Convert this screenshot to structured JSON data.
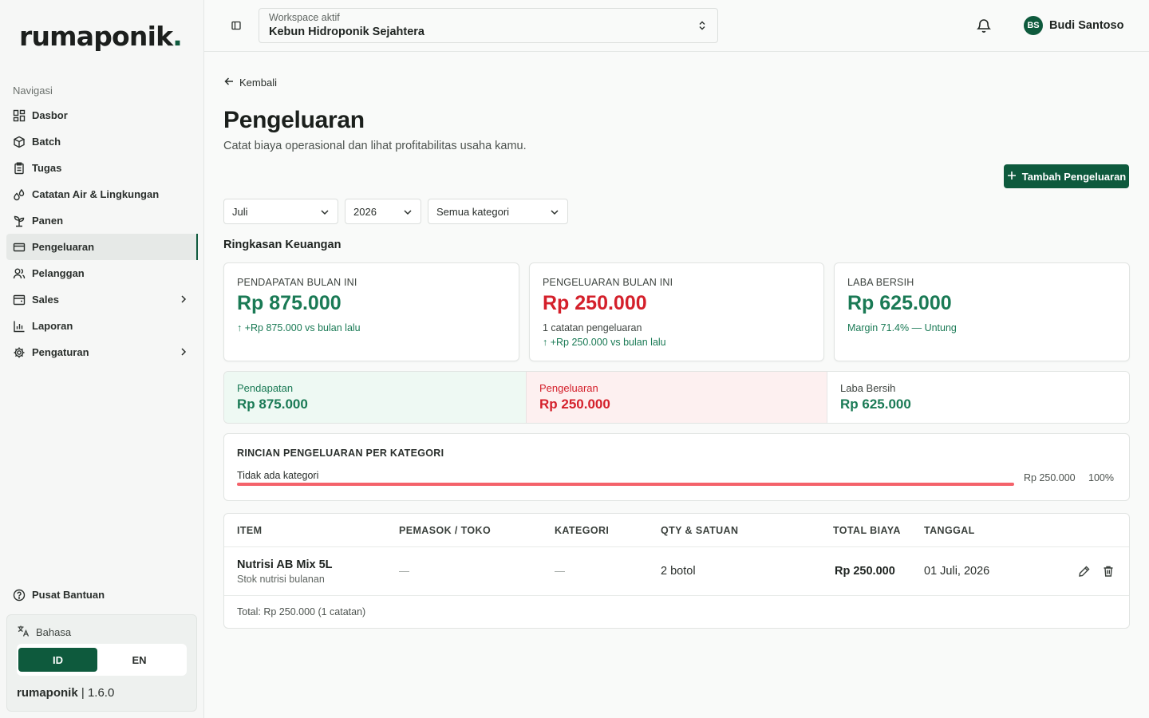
{
  "brand": {
    "logo_main": "rumaponik",
    "logo_dot": "."
  },
  "nav": {
    "heading": "Navigasi",
    "items": [
      {
        "label": "Dasbor",
        "icon": "dashboard-icon"
      },
      {
        "label": "Batch",
        "icon": "box-icon"
      },
      {
        "label": "Tugas",
        "icon": "clipboard-icon"
      },
      {
        "label": "Catatan Air & Lingkungan",
        "icon": "droplets-icon"
      },
      {
        "label": "Panen",
        "icon": "sprout-icon"
      },
      {
        "label": "Pengeluaran",
        "icon": "credit-card-icon",
        "active": true
      },
      {
        "label": "Pelanggan",
        "icon": "users-icon"
      },
      {
        "label": "Sales",
        "icon": "wallet-icon",
        "has_children": true
      },
      {
        "label": "Laporan",
        "icon": "bar-chart-icon"
      },
      {
        "label": "Pengaturan",
        "icon": "gear-icon",
        "has_children": true
      }
    ],
    "help": "Pusat Bantuan"
  },
  "language": {
    "title": "Bahasa",
    "options": [
      "ID",
      "EN"
    ],
    "selected": "ID"
  },
  "version": {
    "name": "rumaponik",
    "separator": "|",
    "number": "1.6.0"
  },
  "header": {
    "workspace_label": "Workspace aktif",
    "workspace_value": "Kebun Hidroponik Sejahtera",
    "user_initials": "BS",
    "user_name": "Budi Santoso"
  },
  "page": {
    "back": "Kembali",
    "title": "Pengeluaran",
    "subtitle": "Catat biaya operasional dan lihat profitabilitas usaha kamu.",
    "add_button": "Tambah Pengeluaran"
  },
  "filters": {
    "month": "Juli",
    "year": "2026",
    "category": "Semua kategori"
  },
  "summary_title": "Ringkasan Keuangan",
  "cards": {
    "income": {
      "label": "PENDAPATAN BULAN INI",
      "value": "Rp 875.000",
      "note": "↑ +Rp 875.000 vs bulan lalu"
    },
    "expense": {
      "label": "PENGELUARAN BULAN INI",
      "value": "Rp 250.000",
      "note1": "1 catatan pengeluaran",
      "note2": "↑ +Rp 250.000 vs bulan lalu"
    },
    "profit": {
      "label": "LABA BERSIH",
      "value": "Rp 625.000",
      "note": "Margin 71.4% — Untung"
    }
  },
  "summary_row": {
    "income": {
      "label": "Pendapatan",
      "value": "Rp 875.000"
    },
    "expense": {
      "label": "Pengeluaran",
      "value": "Rp 250.000"
    },
    "profit": {
      "label": "Laba Bersih",
      "value": "Rp 625.000"
    }
  },
  "category_breakdown": {
    "title": "RINCIAN PENGELUARAN PER KATEGORI",
    "items": [
      {
        "name": "Tidak ada kategori",
        "amount": "Rp 250.000",
        "percent": "100%",
        "share": 1.0
      }
    ]
  },
  "table": {
    "headers": [
      "ITEM",
      "PEMASOK / TOKO",
      "KATEGORI",
      "QTY & SATUAN",
      "TOTAL BIAYA",
      "TANGGAL"
    ],
    "rows": [
      {
        "item": "Nutrisi AB Mix 5L",
        "note": "Stok nutrisi bulanan",
        "supplier": "—",
        "category": "—",
        "qty": "2 botol",
        "total": "Rp 250.000",
        "date": "01 Juli, 2026"
      }
    ],
    "footer": "Total: Rp 250.000 (1 catatan)"
  },
  "colors": {
    "brand": "#0e5a3d",
    "income": "#1a7a55",
    "expense": "#d4202b",
    "bar": "#f4626a"
  }
}
